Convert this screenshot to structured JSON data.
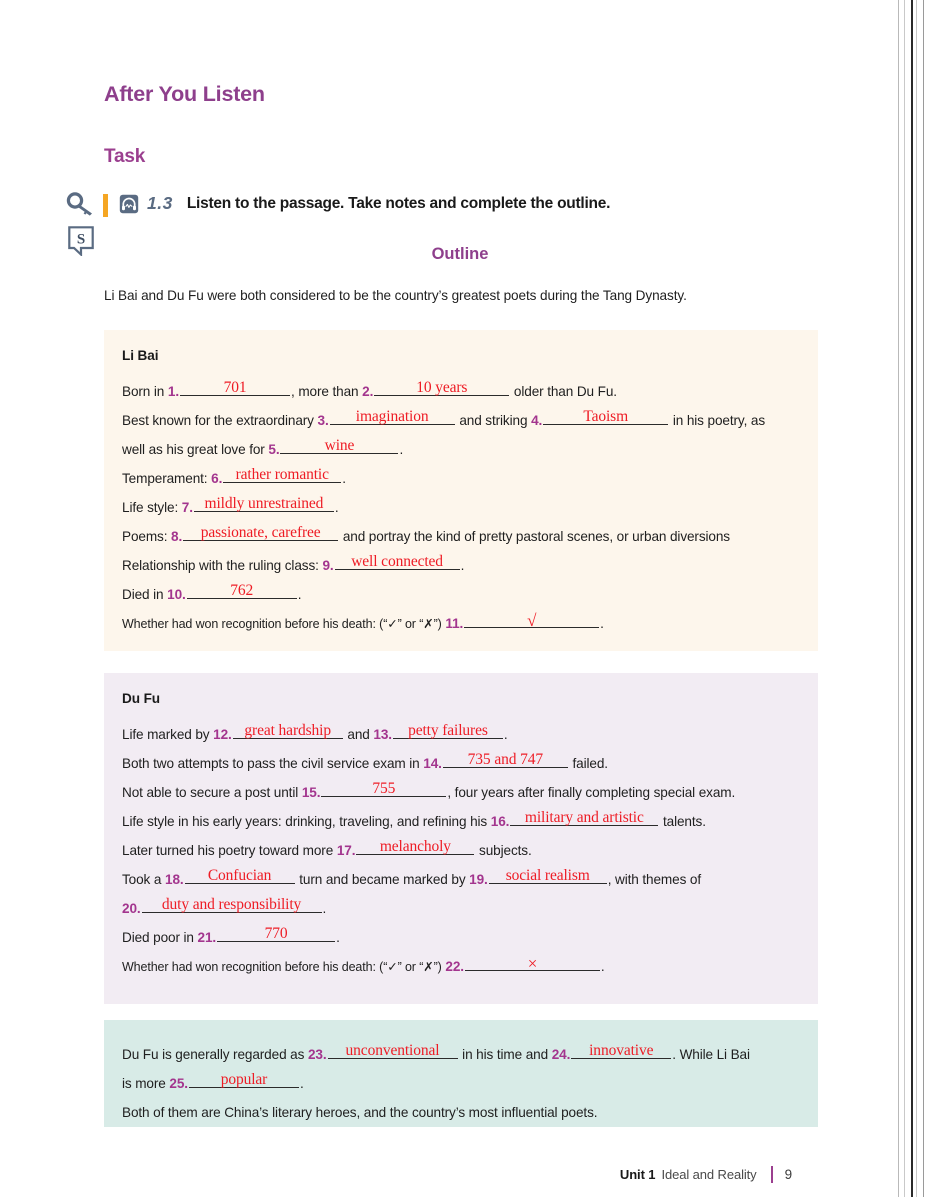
{
  "page": {
    "section_heading": "After You Listen",
    "task_heading": "Task",
    "track_number": "1.3",
    "instruction": "Listen to the passage. Take notes and complete the outline.",
    "outline_title": "Outline",
    "intro": "Li Bai and Du Fu were both considered to be the country’s greatest poets during the Tang Dynasty."
  },
  "icons": {
    "key": "key-icon",
    "bookmark_s": "s-bookmark-icon",
    "headphone": "headphone-icon",
    "orange_bar": "orange-marker"
  },
  "colors": {
    "heading_purple": "#8e3f8c",
    "number_magenta": "#a3358e",
    "answer_red": "#ee1c25",
    "track_slate": "#5a6b82",
    "orange": "#f5a623",
    "box_libai_bg": "#fdf6ec",
    "box_dufu_bg": "#f2ecf3",
    "box_summary_bg": "#d8ebe7"
  },
  "libai": {
    "title": "Li Bai",
    "lines": {
      "l1a": "Born in",
      "l1b": ", more than",
      "l1c": "older than Du Fu.",
      "l2a": "Best known for the extraordinary",
      "l2b": "and striking",
      "l2c": "in his poetry, as",
      "l3a": "well as his great love for",
      "l3b": ".",
      "l4a": "Temperament:",
      "l4b": ".",
      "l5a": "Life style:",
      "l5b": ".",
      "l6a": "Poems:",
      "l6b": "and portray the kind of pretty pastoral scenes, or urban diversions",
      "l7a": "Relationship with the ruling class:",
      "l7b": ".",
      "l8a": "Died in",
      "l8b": ".",
      "l9a": "Whether had won recognition before his death: (“✓” or “✗”)",
      "l9b": "."
    },
    "answers": {
      "n1": "701",
      "n2": "10 years",
      "n3": "imagination",
      "n4": "Taoism",
      "n5": "wine",
      "n6": "rather romantic",
      "n7": "mildly unrestrained",
      "n8": "passionate, carefree",
      "n9": "well connected",
      "n10": "762",
      "n11": "√"
    },
    "numbers": {
      "n1": "1.",
      "n2": "2.",
      "n3": "3.",
      "n4": "4.",
      "n5": "5.",
      "n6": "6.",
      "n7": "7.",
      "n8": "8.",
      "n9": "9.",
      "n10": "10.",
      "n11": "11."
    }
  },
  "dufu": {
    "title": "Du Fu",
    "lines": {
      "l1a": "Life marked by",
      "l1b": "and",
      "l1c": ".",
      "l2a": "Both two attempts to pass the civil service exam in",
      "l2b": "failed.",
      "l3a": "Not able to secure a post until",
      "l3b": ", four years after finally completing special exam.",
      "l4a": "Life style in his early years: drinking, traveling, and refining his",
      "l4b": "talents.",
      "l5a": "Later turned his poetry toward more",
      "l5b": "subjects.",
      "l6a": "Took a",
      "l6b": "turn and became marked by",
      "l6c": ", with themes of",
      "l7b": ".",
      "l8a": "Died poor in",
      "l8b": ".",
      "l9a": "Whether had won recognition before his death: (“✓” or “✗”)",
      "l9b": "."
    },
    "answers": {
      "n12": "great hardship",
      "n13": "petty failures",
      "n14": "735 and 747",
      "n15": "755",
      "n16": "military and artistic",
      "n17": "melancholy",
      "n18": "Confucian",
      "n19": "social realism",
      "n20": "duty and responsibility",
      "n21": "770",
      "n22": "×"
    },
    "numbers": {
      "n12": "12.",
      "n13": "13.",
      "n14": "14.",
      "n15": "15.",
      "n16": "16.",
      "n17": "17.",
      "n18": "18.",
      "n19": "19.",
      "n20": "20.",
      "n21": "21.",
      "n22": "22."
    }
  },
  "summary": {
    "lines": {
      "l1a": "Du Fu is generally regarded as",
      "l1b": "in his time and",
      "l1c": ". While Li Bai",
      "l2a": "is more",
      "l2b": ".",
      "l3": "Both of them are China’s literary heroes, and the country’s most influential poets."
    },
    "answers": {
      "n23": "unconventional",
      "n24": "innovative",
      "n25": "popular"
    },
    "numbers": {
      "n23": "23.",
      "n24": "24.",
      "n25": "25."
    }
  },
  "footer": {
    "unit": "Unit 1",
    "subtitle": "Ideal and Reality",
    "page_number": "9"
  }
}
